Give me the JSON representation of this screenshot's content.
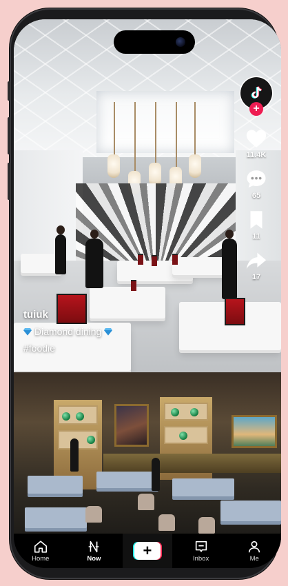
{
  "profile": {
    "follow_symbol": "+",
    "logo_icon": "tiktok-note-icon"
  },
  "actions": {
    "likes": "11.4K",
    "comments": "65",
    "saves": "11",
    "shares": "17"
  },
  "caption": {
    "username": "tuiuk",
    "description": "Diamond dining",
    "hashtag": "#foodie"
  },
  "nav": {
    "home": "Home",
    "now": "Now",
    "create_symbol": "+",
    "inbox": "Inbox",
    "me": "Me"
  },
  "colors": {
    "accent_red": "#fe2c55",
    "accent_cyan": "#25f4ee",
    "navbar_bg": "#000000",
    "backdrop": "#f6cfcc"
  }
}
